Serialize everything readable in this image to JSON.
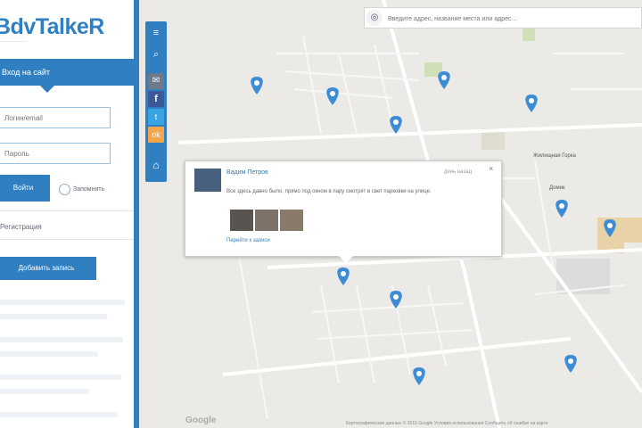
{
  "app": {
    "logo_text": "BdvTalkeR",
    "logo_tagline": "················"
  },
  "login": {
    "header": "Вход на сайт",
    "username_placeholder": "Логин/email",
    "password_placeholder": "Пароль",
    "login_button": "Войти",
    "remember_label": "Запомнить",
    "register_link": "Регистрация",
    "add_button": "Добавить запись"
  },
  "toolbar": {
    "icons": [
      "list-icon",
      "search-icon",
      "mail-icon",
      "facebook-icon",
      "twitter-icon",
      "odnoklassniki-icon",
      "home-icon"
    ],
    "colors": {
      "mail": "#6c7a8a",
      "facebook": "#3b5998",
      "twitter": "#3aa3e3",
      "odnoklassniki": "#f2a54a"
    }
  },
  "search": {
    "placeholder": "Введите адрес, название места или адрес..."
  },
  "popup": {
    "username": "Вадим Петров",
    "time": "день назад",
    "text": "Все здесь давно было, прямо под окном в пару смотрят в свет парковки на улице.",
    "link": "Перейти к записи",
    "close": "×"
  },
  "map": {
    "labels": [
      "Жилищная Горка",
      "Домик"
    ],
    "google": "Google",
    "attribution": "Картографические данные © 2015 Google   Условия использования   Сообщить об ошибке на карте"
  },
  "colors": {
    "accent": "#2f7fc1",
    "marker": "#3d8dd6",
    "map_bg": "#ebeae6"
  }
}
